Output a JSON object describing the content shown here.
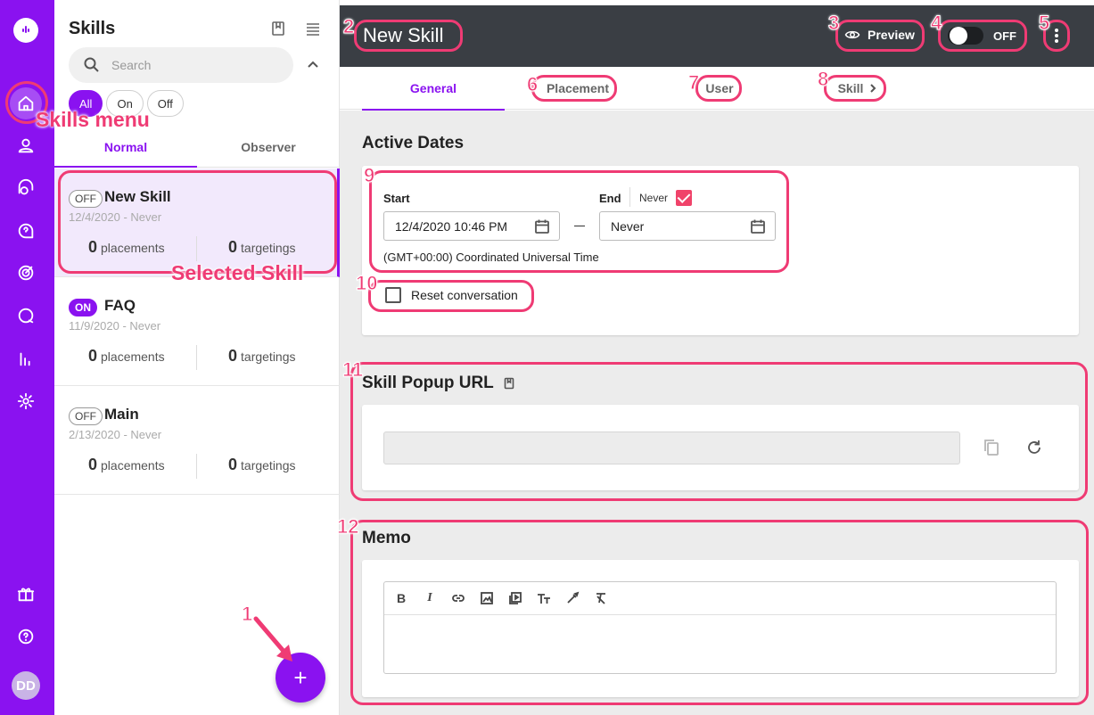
{
  "colors": {
    "accent": "#8a12f0",
    "annotation": "#ef3b74",
    "topbar": "#3a3e44"
  },
  "rail": {
    "items": [
      "home-icon",
      "user-icon",
      "chat-icon",
      "help-icon",
      "target-icon",
      "message-icon",
      "analytics-icon",
      "gear-icon"
    ],
    "bottom": [
      "gift-icon",
      "help-circle-icon"
    ],
    "avatar": "DD"
  },
  "panel": {
    "title": "Skills",
    "search": {
      "placeholder": "Search"
    },
    "filters": [
      {
        "label": "All",
        "selected": true
      },
      {
        "label": "On",
        "selected": false
      },
      {
        "label": "Off",
        "selected": false
      }
    ],
    "tabs": [
      {
        "label": "Normal",
        "selected": true
      },
      {
        "label": "Observer",
        "selected": false
      }
    ],
    "skills": [
      {
        "status": "OFF",
        "name": "New Skill",
        "dates": "12/4/2020 - Never",
        "placements": "0",
        "placements_label": "placements",
        "targetings": "0",
        "targetings_label": "targetings",
        "selected": true
      },
      {
        "status": "ON",
        "name": "FAQ",
        "dates": "11/9/2020 - Never",
        "placements": "0",
        "placements_label": "placements",
        "targetings": "0",
        "targetings_label": "targetings",
        "selected": false
      },
      {
        "status": "OFF",
        "name": "Main",
        "dates": "2/13/2020 - Never",
        "placements": "0",
        "placements_label": "placements",
        "targetings": "0",
        "targetings_label": "targetings",
        "selected": false
      }
    ],
    "fab_label": "+"
  },
  "topbar": {
    "title": "New Skill",
    "preview_label": "Preview",
    "toggle_label": "OFF"
  },
  "tabs": [
    {
      "label": "General",
      "selected": true
    },
    {
      "label": "Placement",
      "selected": false
    },
    {
      "label": "User",
      "selected": false
    },
    {
      "label": "Skill",
      "selected": false
    }
  ],
  "active_dates": {
    "title": "Active Dates",
    "start_label": "Start",
    "end_label": "End",
    "never_label": "Never",
    "never_checked": true,
    "start_value": "12/4/2020 10:46 PM",
    "end_value": "Never",
    "timezone": "(GMT+00:00) Coordinated Universal Time",
    "reset_label": "Reset conversation",
    "reset_checked": false
  },
  "popup_url": {
    "title": "Skill Popup URL",
    "value": ""
  },
  "memo": {
    "title": "Memo",
    "toolbar": [
      "B",
      "I",
      "link-icon",
      "image-icon",
      "video-icon",
      "text-size-icon",
      "color-picker-icon",
      "clear-format-icon"
    ]
  },
  "annotations": {
    "numbers": [
      "1",
      "2",
      "3",
      "4",
      "5",
      "6",
      "7",
      "8",
      "9",
      "10",
      "11",
      "12"
    ],
    "skills_menu": "Skills menu",
    "selected_skill": "Selected Skill"
  }
}
